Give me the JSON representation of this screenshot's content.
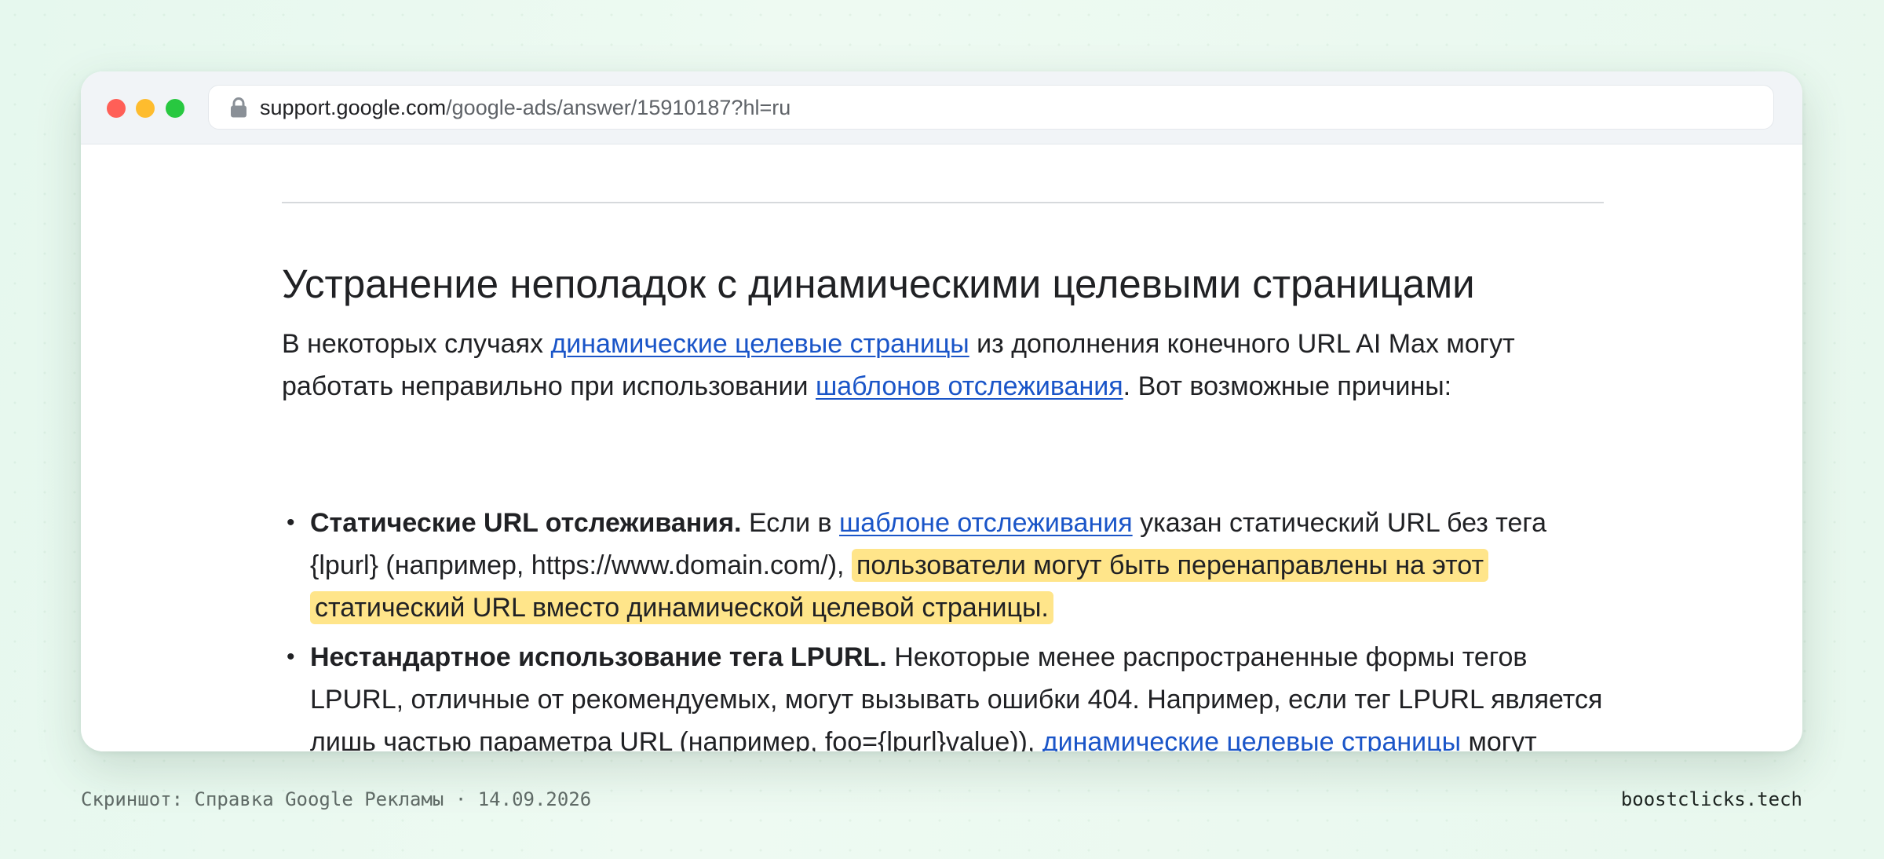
{
  "browser": {
    "url_host": "support.google.com",
    "url_path": "/google-ads/answer/15910187?hl=ru",
    "lock_icon": "lock-icon",
    "window_controls": [
      "close",
      "minimize",
      "zoom"
    ]
  },
  "article": {
    "heading": "Устранение неполадок с динамическими целевыми страницами",
    "intro": {
      "t1": "В некоторых случаях ",
      "link1": "динамические целевые страницы",
      "t2": " из дополнения конечного URL AI Max могут работать неправильно при использовании ",
      "link2": "шаблонов отслеживания",
      "t3": ". Вот возможные причины:"
    },
    "bullets": [
      {
        "term": "Статические URL отслеживания.",
        "t1": " Если в ",
        "link": "шаблоне отслеживания",
        "t2": " указан статический URL без тега {lpurl} (например, https://www.domain.com/), ",
        "highlight": "пользователи могут быть перенаправлены на этот статический URL вместо динамической целевой страницы."
      },
      {
        "term": "Нестандартное использование тега LPURL.",
        "t1": " Некоторые менее распространенные формы тегов LPURL, отличные от рекомендуемых, могут вызывать ошибки 404. Например, если тег LPURL является лишь частью параметра URL (например, foo={lpurl}value)), ",
        "link": "динамические целевые страницы",
        "t2": " могут работать неправильно."
      }
    ],
    "highlight_color": "#ffe58a",
    "link_color": "#1a55c8"
  },
  "footer": {
    "caption": "Скриншот: Справка Google Рекламы · 14.09.2026",
    "brand": "boostclicks.tech"
  }
}
